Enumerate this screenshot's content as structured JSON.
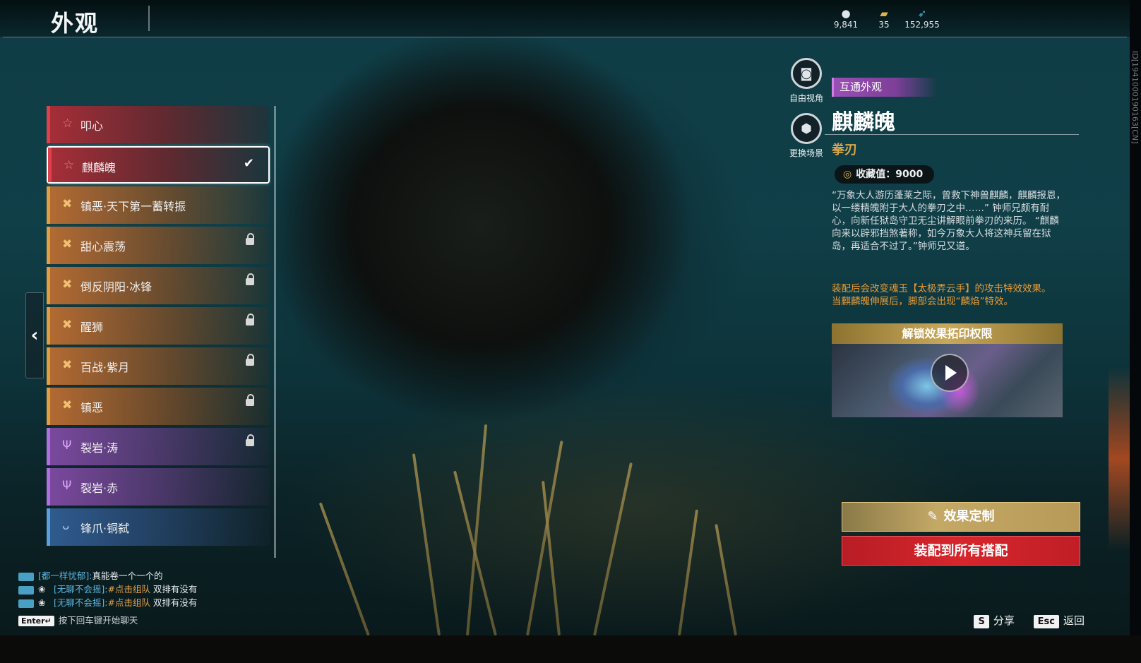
{
  "header": {
    "title": "外观",
    "currencies": [
      {
        "icon": "orb-icon",
        "value": "9,841"
      },
      {
        "icon": "ticket-icon",
        "value": "35"
      },
      {
        "icon": "feather-icon",
        "value": "152,955"
      }
    ],
    "version_id": "ID[1941000190163[CN]"
  },
  "skin_list": {
    "items": [
      {
        "label": "叩心",
        "color": "red",
        "icon": "star-icon",
        "locked": false,
        "selected": false
      },
      {
        "label": "麒麟魄",
        "color": "red",
        "icon": "star-icon",
        "locked": false,
        "selected": true
      },
      {
        "label": "镇恶·天下第一蓄转振",
        "color": "orange",
        "icon": "cross-icon",
        "locked": false,
        "selected": false
      },
      {
        "label": "甜心震荡",
        "color": "orange",
        "icon": "cross-icon",
        "locked": true,
        "selected": false
      },
      {
        "label": "倒反阴阳·冰锋",
        "color": "orange",
        "icon": "cross-icon",
        "locked": true,
        "selected": false
      },
      {
        "label": "醒狮",
        "color": "orange",
        "icon": "cross-icon",
        "locked": true,
        "selected": false
      },
      {
        "label": "百战·紫月",
        "color": "orange",
        "icon": "cross-icon",
        "locked": true,
        "selected": false
      },
      {
        "label": "镇恶",
        "color": "orange",
        "icon": "cross-icon",
        "locked": true,
        "selected": false
      },
      {
        "label": "裂岩·涛",
        "color": "purple",
        "icon": "fork-icon",
        "locked": true,
        "selected": false
      },
      {
        "label": "裂岩·赤",
        "color": "purple",
        "icon": "fork-icon",
        "locked": false,
        "selected": false
      },
      {
        "label": "锋爪·铜弑",
        "color": "blue",
        "icon": "wing-icon",
        "locked": false,
        "selected": false
      }
    ]
  },
  "camera_controls": {
    "free_view": "自由视角",
    "change_scene": "更换场景"
  },
  "detail": {
    "tag": "互通外观",
    "name": "麒麟魄",
    "weapon": "拳刃",
    "collect_value": "收藏值：9000",
    "description": "“万象大人游历蓬莱之际，曾救下神兽麒麟，麒麟报恩，以一缕精魄附于大人的拳刃之中……” 钟师兄颇有耐心，向新任狱岛守卫无尘讲解眼前拳刃的来历。 “麒麟向来以辟邪挡煞著称，如今万象大人将这神兵留在狱岛，再适合不过了。”钟师兄又道。",
    "effect_line1": "装配后会改变魂玉【太极弄云手】的攻击特效效果。",
    "effect_line2": "当麒麟魄伸展后，脚部会出现“麟焰”特效。",
    "unlock_label": "解锁效果拓印权限"
  },
  "actions": {
    "customize": "效果定制",
    "equip_all": "装配到所有搭配"
  },
  "chat": {
    "messages": [
      {
        "sender": "[都一样忧郁]:",
        "tag": "",
        "text": "真能卷一个一个的"
      },
      {
        "sender": "[无聊不会摇]:",
        "tag": "#点击组队",
        "text": " 双排有没有"
      },
      {
        "sender": "[无聊不会摇]:",
        "tag": "#点击组队",
        "text": " 双排有没有"
      }
    ],
    "enter_key": "Enter↵",
    "enter_hint": "按下回车键开始聊天"
  },
  "hints": {
    "share_key": "S",
    "share_label": "分享",
    "back_key": "Esc",
    "back_label": "返回"
  },
  "colors": {
    "accent_gold": "#c9a85a",
    "equip_red": "#d7262c",
    "tag_purple": "#9a4fb4",
    "weapon_gold": "#d9a64a",
    "effect_orange": "#e89a36"
  }
}
